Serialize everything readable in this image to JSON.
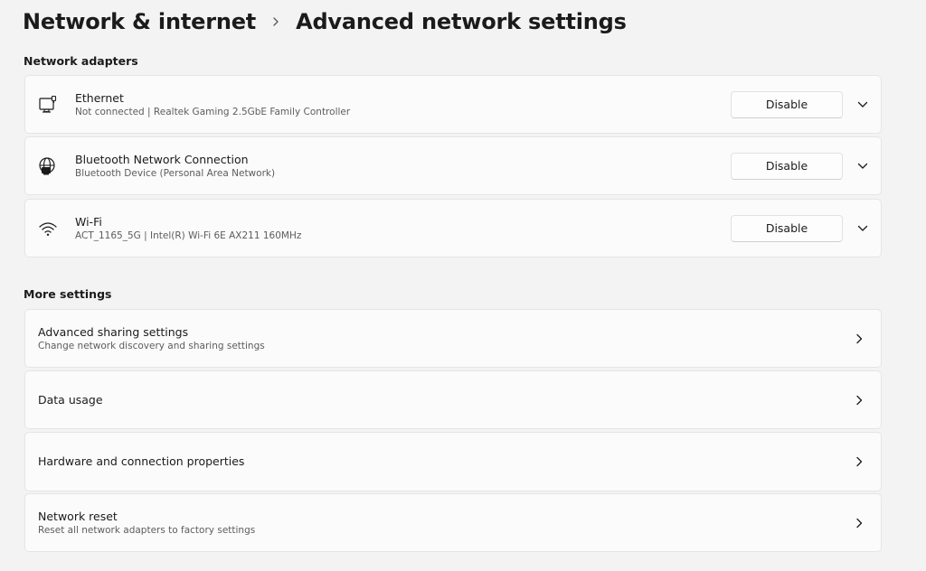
{
  "breadcrumb": {
    "parent": "Network & internet",
    "current": "Advanced network settings"
  },
  "sections": {
    "adapters_title": "Network adapters",
    "more_title": "More settings"
  },
  "adapters": [
    {
      "icon": "ethernet-icon",
      "name": "Ethernet",
      "detail": "Not connected | Realtek Gaming 2.5GbE Family Controller",
      "button": "Disable"
    },
    {
      "icon": "bluetooth-network-icon",
      "name": "Bluetooth Network Connection",
      "detail": "Bluetooth Device (Personal Area Network)",
      "button": "Disable"
    },
    {
      "icon": "wifi-icon",
      "name": "Wi-Fi",
      "detail": "ACT_1165_5G | Intel(R) Wi-Fi 6E AX211 160MHz",
      "button": "Disable"
    }
  ],
  "more_settings": [
    {
      "title": "Advanced sharing settings",
      "subtitle": "Change network discovery and sharing settings"
    },
    {
      "title": "Data usage"
    },
    {
      "title": "Hardware and connection properties"
    },
    {
      "title": "Network reset",
      "subtitle": "Reset all network adapters to factory settings"
    }
  ]
}
